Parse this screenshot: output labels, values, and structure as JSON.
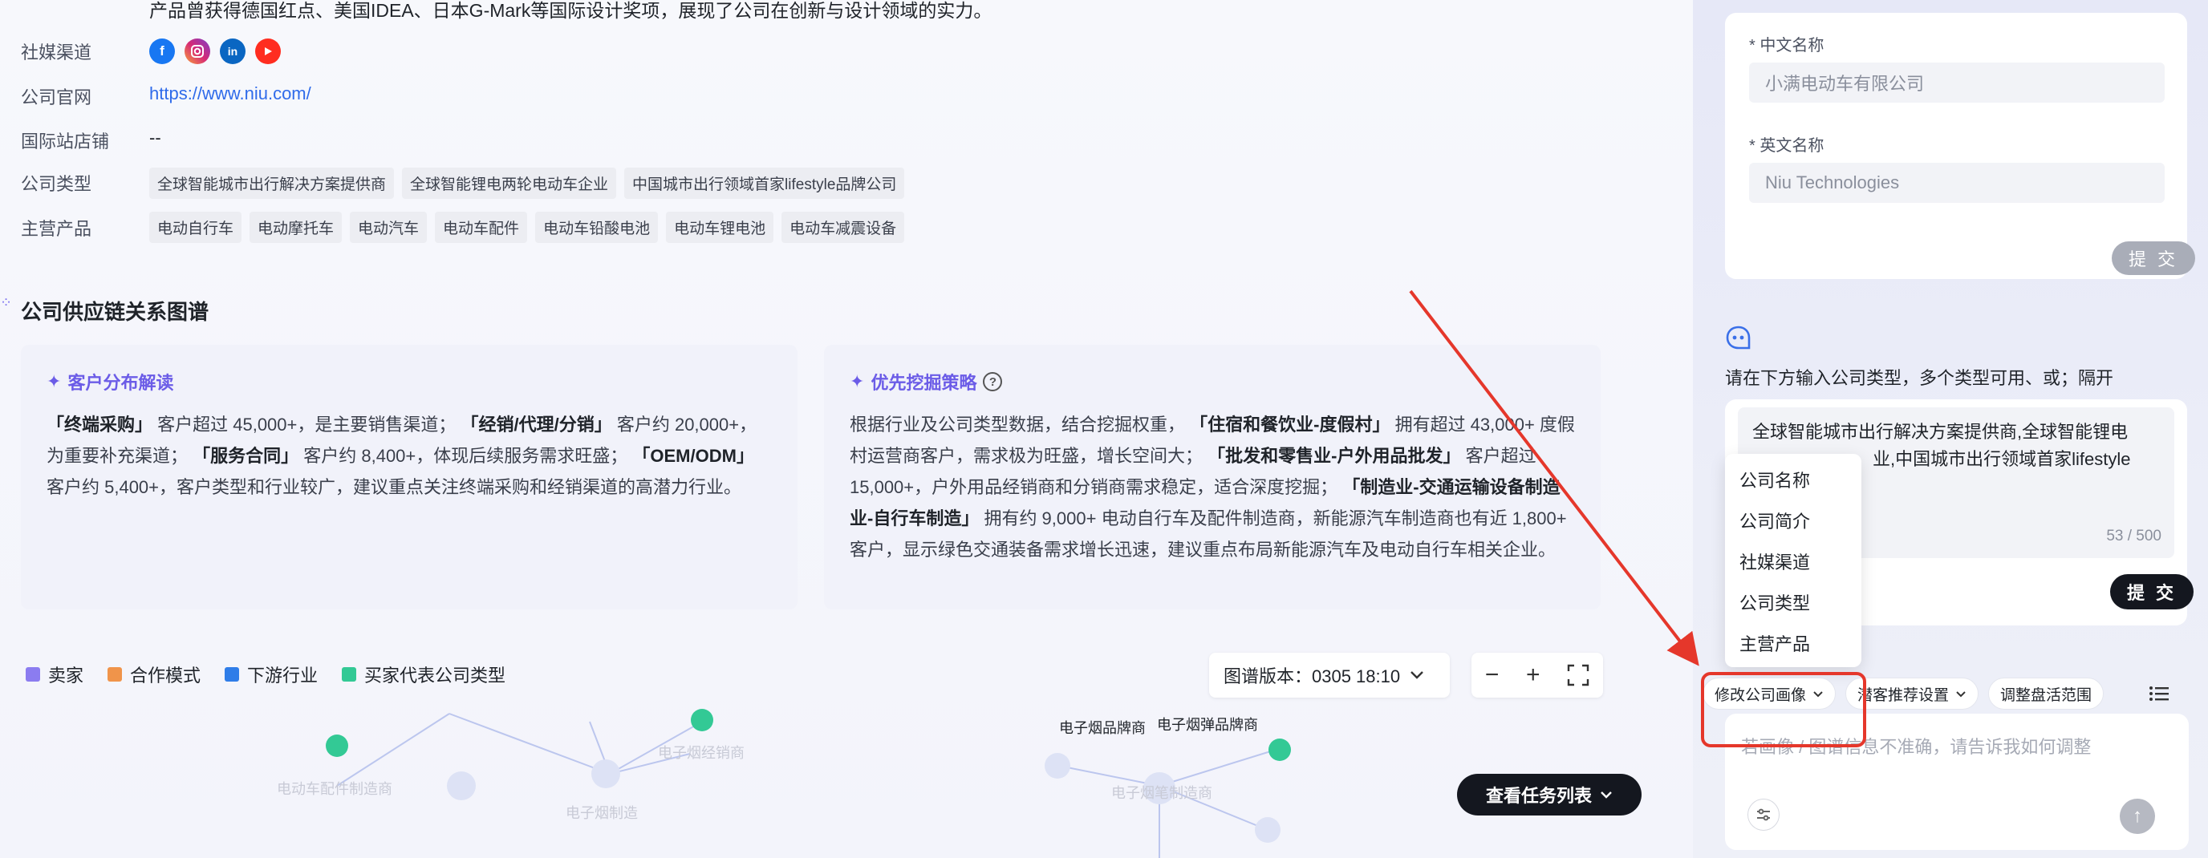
{
  "intro": {
    "text": "产品曾获得德国红点、美国IDEA、日本G-Mark等国际设计奖项，展现了公司在创新与设计领域的实力。"
  },
  "info": {
    "social_label": "社媒渠道",
    "social_icons": [
      "facebook-icon",
      "instagram-icon",
      "linkedin-icon",
      "youtube-icon"
    ],
    "website_label": "公司官网",
    "website_value": "https://www.niu.com/",
    "intl_store_label": "国际站店铺",
    "intl_store_value": "--",
    "company_type_label": "公司类型",
    "company_types": [
      "全球智能城市出行解决方案提供商",
      "全球智能锂电两轮电动车企业",
      "中国城市出行领域首家lifestyle品牌公司"
    ],
    "main_products_label": "主营产品",
    "main_products": [
      "电动自行车",
      "电动摩托车",
      "电动汽车",
      "电动车配件",
      "电动车铅酸电池",
      "电动车锂电池",
      "电动车减震设备"
    ]
  },
  "supply_chain": {
    "title": "公司供应链关系图谱",
    "customer_card": {
      "title": "客户分布解读",
      "segments": [
        {
          "bold": "「终端采购」",
          "text": " 客户超过 45,000+，是主要销售渠道； "
        },
        {
          "bold": "「经销/代理/分销」",
          "text": " 客户约 20,000+，为重要补充渠道； "
        },
        {
          "bold": "「服务合同」",
          "text": " 客户约 8,400+，体现后续服务需求旺盛； "
        },
        {
          "bold": "「OEM/ODM」",
          "text": " 客户约 5,400+，客户类型和行业较广，建议重点关注终端采购和经销渠道的高潜力行业。"
        }
      ]
    },
    "strategy_card": {
      "title": "优先挖掘策略",
      "segments": [
        {
          "bold": "",
          "text": "根据行业及公司类型数据，结合挖掘权重， "
        },
        {
          "bold": "「住宿和餐饮业-度假村」",
          "text": " 拥有超过 43,000+ 度假村运营商客户，需求极为旺盛，增长空间大； "
        },
        {
          "bold": "「批发和零售业-户外用品批发」",
          "text": " 客户超过 15,000+，户外用品经销商和分销商需求稳定，适合深度挖掘； "
        },
        {
          "bold": "「制造业-交通运输设备制造业-自行车制造」",
          "text": " 拥有约 9,000+ 电动自行车及配件制造商，新能源汽车制造商也有近 1,800+ 客户，显示绿色交通装备需求增长迅速，建议重点布局新能源汽车及电动自行车相关企业。"
        }
      ]
    },
    "legend": [
      {
        "label": "卖家",
        "color": "#8b7cf0"
      },
      {
        "label": "合作模式",
        "color": "#f0944a"
      },
      {
        "label": "下游行业",
        "color": "#2f7de8"
      },
      {
        "label": "买家代表公司类型",
        "color": "#33c995"
      }
    ],
    "version_label": "图谱版本：0305 18:10",
    "graph_labels": [
      "电子烟品牌商",
      "电子烟弹品牌商",
      "电子烟经销商",
      "电子烟制造",
      "电子烟笔制造商",
      "电动车配件制造商"
    ],
    "task_button": "查看任务列表"
  },
  "panel": {
    "cn_name_label": "* 中文名称",
    "cn_name_value": "小满电动车有限公司",
    "en_name_label": "* 英文名称",
    "en_name_value": "Niu Technologies",
    "submit_label": "提 交",
    "instruction": "请在下方输入公司类型，多个类型可用、或；隔开",
    "textarea_line1": "全球智能城市出行解决方案提供商,全球智能锂电",
    "textarea_line2": "业,中国城市出行领域首家lifestyle",
    "char_count": "53 / 500",
    "submit2_label": "提 交",
    "dropdown_items": [
      "公司名称",
      "公司简介",
      "社媒渠道",
      "公司类型",
      "主营产品"
    ],
    "chips": [
      "修改公司画像",
      "潜客推荐设置",
      "调整盘活范围"
    ],
    "chat_placeholder": "若画像 / 图谱信息不准确，请告诉我如何调整"
  },
  "colors": {
    "accent": "#6b5ce7",
    "annotation_red": "#e5372b",
    "link": "#2f6bea"
  }
}
